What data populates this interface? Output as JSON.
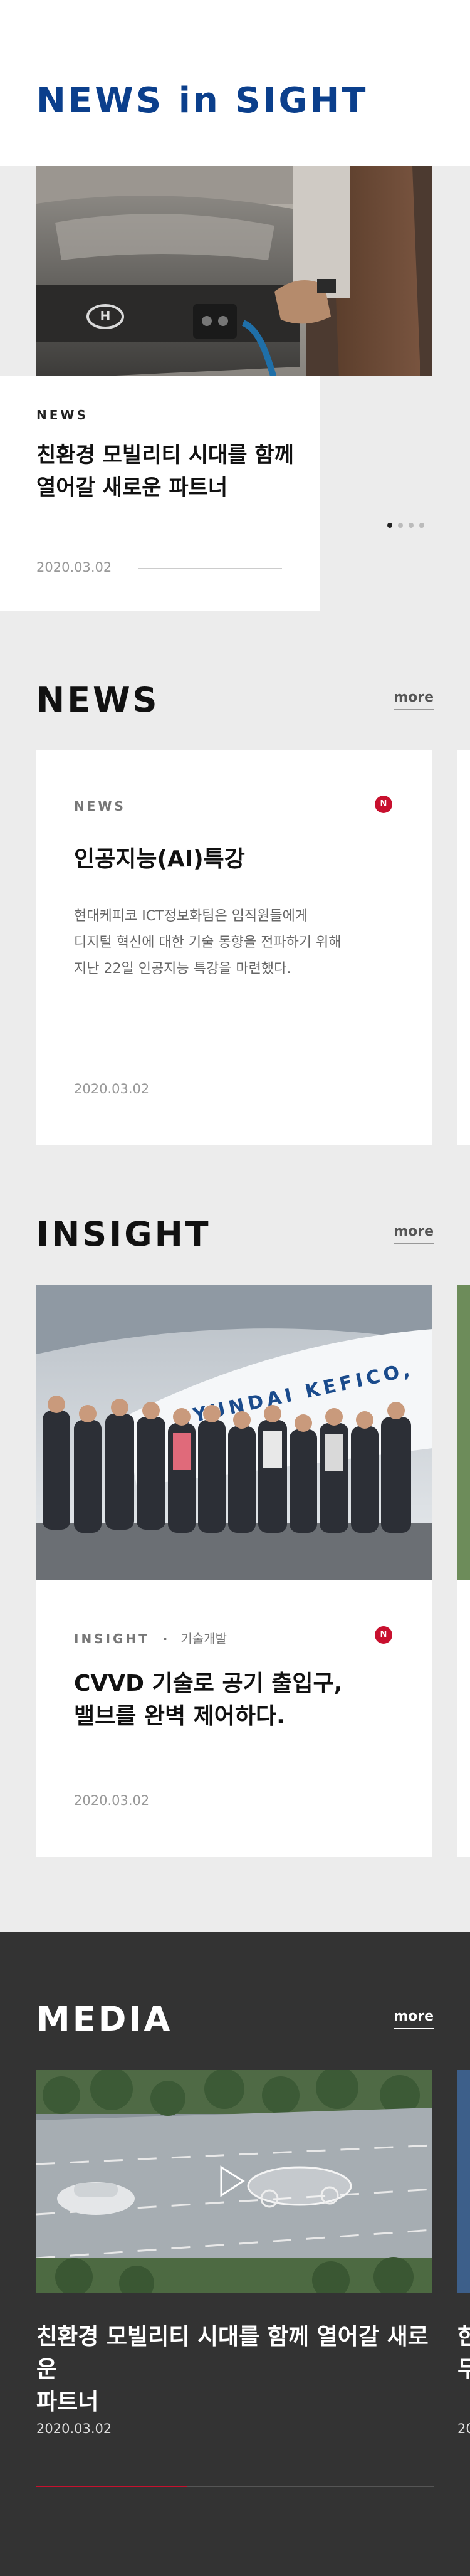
{
  "hero": {
    "title": "NEWS in SIGHT",
    "label": "NEWS",
    "headline": "친환경 모빌리티 시대를 함께 열어갈 새로운 파트너",
    "date": "2020.03.02",
    "slides_total": 4,
    "slide_active": 1
  },
  "news": {
    "title": "NEWS",
    "more": "more",
    "card": {
      "label": "NEWS",
      "badge": "N",
      "title": "인공지능(AI)특강",
      "body_lines": [
        "현대케피코 ICT정보화팀은 임직원들에게",
        "디지털 혁신에 대한 기술 동향을 전파하기 위해",
        "지난 22일 인공지능 특강을 마련했다."
      ],
      "date": "2020.03.02"
    }
  },
  "insight": {
    "title": "INSIGHT",
    "more": "more",
    "card": {
      "label": "INSIGHT",
      "separator": "·",
      "category": "기술개발",
      "badge": "N",
      "title_lines": [
        "CVVD 기술로 공기 출입구,",
        "밸브를 완벽 제어하다."
      ],
      "date": "2020.03.02",
      "photo_sign": "HYUNDAI KEFICO,"
    }
  },
  "media": {
    "title": "MEDIA",
    "more": "more",
    "card": {
      "title_lines": [
        "친환경 모빌리티 시대를 함께 열어갈 새로운",
        "파트너"
      ],
      "date": "2020.03.02"
    },
    "peek": {
      "title_lines": [
        "한",
        "무"
      ],
      "date": "20"
    },
    "progress": 0.38
  },
  "colors": {
    "brand_blue": "#0b3f8c",
    "accent_red": "#c8102e",
    "dark_bg": "#333333",
    "light_bg": "#ececec"
  }
}
